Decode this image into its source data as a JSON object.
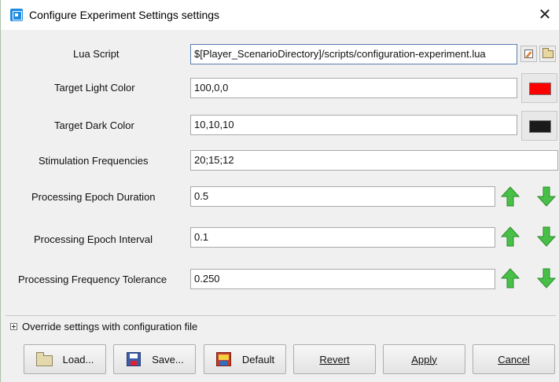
{
  "window": {
    "title": "Configure Experiment Settings settings",
    "close_glyph": "✕",
    "icon": "app-window-icon"
  },
  "settings": {
    "lua_script": {
      "label": "Lua Script",
      "value": "$[Player_ScenarioDirectory]/scripts/configuration-experiment.lua",
      "edit_icon": "edit-icon",
      "browse_icon": "folder-icon"
    },
    "target_light_color": {
      "label": "Target Light Color",
      "value": "100,0,0",
      "swatch_color": "#ff0000"
    },
    "target_dark_color": {
      "label": "Target Dark Color",
      "value": "10,10,10",
      "swatch_color": "#1a1a1a"
    },
    "stimulation_frequencies": {
      "label": "Stimulation Frequencies",
      "value": "20;15;12"
    },
    "processing_epoch_duration": {
      "label": "Processing Epoch Duration",
      "value": "0.5"
    },
    "processing_epoch_interval": {
      "label": "Processing Epoch Interval",
      "value": "0.1"
    },
    "processing_frequency_tolerance": {
      "label": "Processing Frequency Tolerance",
      "value": "0.250"
    },
    "arrow_colors": {
      "up": "#3cb33c",
      "down": "#3cb33c"
    }
  },
  "override": {
    "label": "Override settings with configuration file"
  },
  "buttons": {
    "load": "Load...",
    "save": "Save...",
    "default": "Default",
    "revert": "Revert",
    "apply": "Apply",
    "cancel": "Cancel"
  }
}
